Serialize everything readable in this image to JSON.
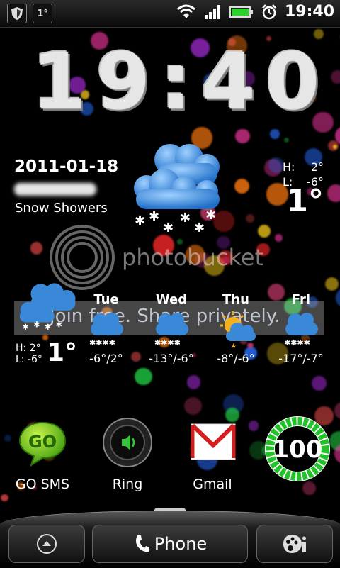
{
  "status_bar": {
    "notification_temp": "1°",
    "time": "19:40"
  },
  "clock": {
    "time": "19:40"
  },
  "weather": {
    "date": "2011-01-18",
    "condition": "Snow Showers",
    "high": "H:",
    "high_value": "2°",
    "low": "L:",
    "low_value": "-6°",
    "current_temp": "1°"
  },
  "watermark": {
    "brand": "photobucket",
    "band_text": "Join free. Share privately."
  },
  "forecast": {
    "today": {
      "high": "H: 2°",
      "low": "L: -6°",
      "temp": "1°"
    },
    "days": [
      {
        "name": "Tue",
        "temps": "-6°/2°",
        "icon": "snow-icon"
      },
      {
        "name": "Wed",
        "temps": "-13°/-6°",
        "icon": "snow-icon"
      },
      {
        "name": "Thu",
        "temps": "-8°/-6°",
        "icon": "sun-cloud-icon"
      },
      {
        "name": "Fri",
        "temps": "-17°/-7°",
        "icon": "snow-icon"
      }
    ]
  },
  "apps": [
    {
      "label": "GO SMS",
      "icon": "go-sms-icon",
      "badge": "GO"
    },
    {
      "label": "Ring",
      "icon": "speaker-icon"
    },
    {
      "label": "Gmail",
      "icon": "gmail-icon"
    }
  ],
  "battery_widget": {
    "value": "100",
    "color": "#22c22a"
  },
  "dock": {
    "phone_label": "Phone"
  },
  "colors": {
    "cloud_blue": "#3a88d8",
    "battery_green": "#22c22a"
  }
}
